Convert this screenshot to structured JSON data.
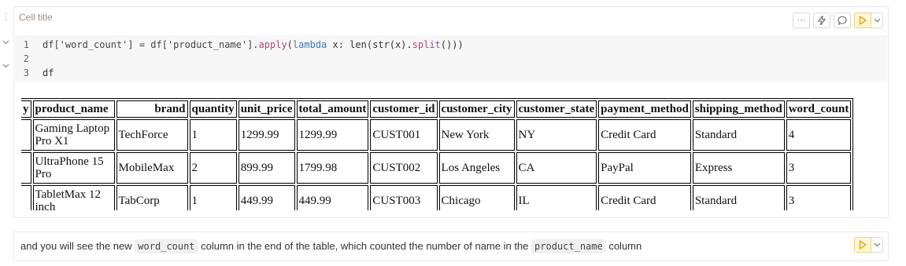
{
  "cell1": {
    "title": "Cell title",
    "toolbar": {
      "more_label": "···"
    },
    "code": {
      "line_numbers": [
        "1",
        "2",
        "3"
      ],
      "line1": {
        "a": "df['word_count'] = df['product_name'].",
        "apply": "apply",
        "b": "(",
        "lambda": "lambda",
        "c": " x: len(str(x).",
        "split": "split",
        "d": "()))"
      },
      "line3": "df"
    },
    "table": {
      "headers": [
        "y",
        "product_name",
        "brand",
        "quantity",
        "unit_price",
        "total_amount",
        "customer_id",
        "customer_city",
        "customer_state",
        "payment_method",
        "shipping_method",
        "word_count"
      ],
      "rows": [
        [
          "",
          "Gaming Laptop Pro X1",
          "TechForce",
          "1",
          "1299.99",
          "1299.99",
          "CUST001",
          "New York",
          "NY",
          "Credit Card",
          "Standard",
          "4"
        ],
        [
          "",
          "UltraPhone 15 Pro",
          "MobileMax",
          "2",
          "899.99",
          "1799.98",
          "CUST002",
          "Los Angeles",
          "CA",
          "PayPal",
          "Express",
          "3"
        ],
        [
          "",
          "TabletMax 12 inch",
          "TabCorp",
          "1",
          "449.99",
          "449.99",
          "CUST003",
          "Chicago",
          "IL",
          "Credit Card",
          "Standard",
          "3"
        ]
      ]
    }
  },
  "cell2": {
    "text_before": "and you will see the new ",
    "code1": "word_count",
    "text_middle": " column in the end of the table, which counted the number of name in the ",
    "code2": "product_name",
    "text_after": " column"
  },
  "colors": {
    "run_accent": "#f5c542",
    "code_bg": "#f7f7f7",
    "fn": "#b0457f",
    "kw": "#3b7ac4"
  }
}
